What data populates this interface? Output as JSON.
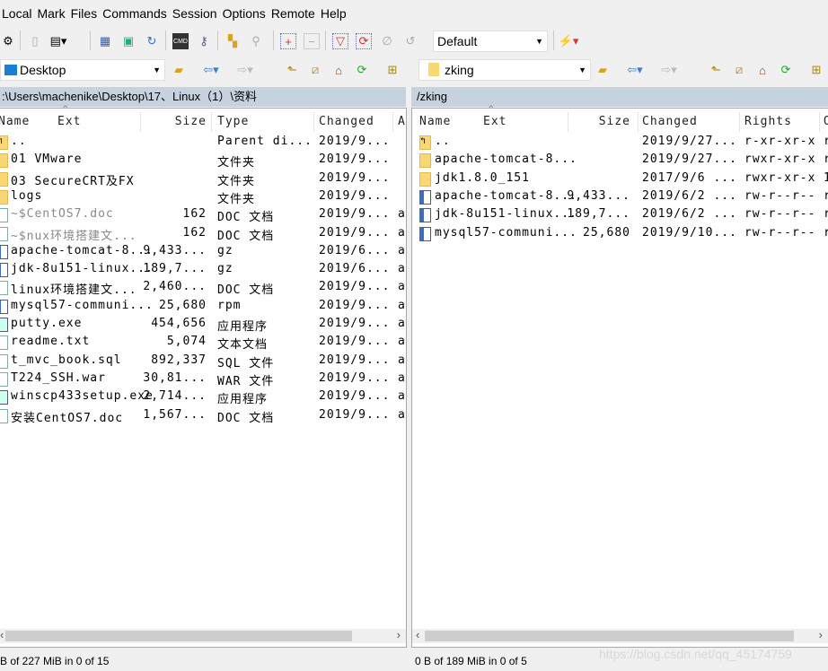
{
  "menu": [
    "Local",
    "Mark",
    "Files",
    "Commands",
    "Session",
    "Options",
    "Remote",
    "Help"
  ],
  "toolbar": {
    "profile": "Default"
  },
  "left": {
    "location": "Desktop",
    "path": ":\\Users\\machenike\\Desktop\\17、Linux（1）\\资料",
    "columns": [
      "Name",
      "Ext",
      "Size",
      "Type",
      "Changed",
      "A"
    ],
    "rows": [
      {
        "icon": "parent-folder",
        "name": "..",
        "size": "",
        "type": "Parent di...",
        "changed": "2019/9...",
        "attr": ""
      },
      {
        "icon": "folder",
        "name": "01 VMware",
        "size": "",
        "type": "文件夹",
        "changed": "2019/9...",
        "attr": ""
      },
      {
        "icon": "folder",
        "name": "03 SecureCRT及FX",
        "size": "",
        "type": "文件夹",
        "changed": "2019/9...",
        "attr": ""
      },
      {
        "icon": "folder",
        "name": "logs",
        "size": "",
        "type": "文件夹",
        "changed": "2019/9...",
        "attr": ""
      },
      {
        "icon": "doc",
        "name": "~$CentOS7.doc",
        "size": "162",
        "type": "DOC 文档",
        "changed": "2019/9...",
        "attr": "a",
        "hidden": true
      },
      {
        "icon": "doc",
        "name": "~$nux环境搭建文...",
        "size": "162",
        "type": "DOC 文档",
        "changed": "2019/9...",
        "attr": "a",
        "hidden": true
      },
      {
        "icon": "package",
        "name": "apache-tomcat-8...",
        "size": "9,433...",
        "type": "gz",
        "changed": "2019/6...",
        "attr": "a"
      },
      {
        "icon": "package",
        "name": "jdk-8u151-linux...",
        "size": "189,7...",
        "type": "gz",
        "changed": "2019/6...",
        "attr": "a"
      },
      {
        "icon": "doc",
        "name": "linux环境搭建文...",
        "size": "2,460...",
        "type": "DOC 文档",
        "changed": "2019/9...",
        "attr": "a"
      },
      {
        "icon": "package",
        "name": "mysql57-communi...",
        "size": "25,680",
        "type": "rpm",
        "changed": "2019/9...",
        "attr": "a"
      },
      {
        "icon": "exe",
        "name": "putty.exe",
        "size": "454,656",
        "type": "应用程序",
        "changed": "2019/9...",
        "attr": "a"
      },
      {
        "icon": "doc",
        "name": "readme.txt",
        "size": "5,074",
        "type": "文本文档",
        "changed": "2019/9...",
        "attr": "a"
      },
      {
        "icon": "doc",
        "name": "t_mvc_book.sql",
        "size": "892,337",
        "type": "SQL 文件",
        "changed": "2019/9...",
        "attr": "a"
      },
      {
        "icon": "doc",
        "name": "T224_SSH.war",
        "size": "30,81...",
        "type": "WAR 文件",
        "changed": "2019/9...",
        "attr": "a"
      },
      {
        "icon": "exe",
        "name": "winscp433setup.exe",
        "size": "2,714...",
        "type": "应用程序",
        "changed": "2019/9...",
        "attr": "a"
      },
      {
        "icon": "doc",
        "name": "安装CentOS7.doc",
        "size": "1,567...",
        "type": "DOC 文档",
        "changed": "2019/9...",
        "attr": "a"
      }
    ],
    "status": "B of 227 MiB in 0 of 15"
  },
  "right": {
    "location": "zking",
    "path": "/zking",
    "columns": [
      "Name",
      "Ext",
      "Size",
      "Changed",
      "Rights",
      "O"
    ],
    "rows": [
      {
        "icon": "parent-folder",
        "name": "..",
        "size": "",
        "changed": "2019/9/27...",
        "rights": "r-xr-xr-x",
        "owner": "r"
      },
      {
        "icon": "folder",
        "name": "apache-tomcat-8...",
        "size": "",
        "changed": "2019/9/27...",
        "rights": "rwxr-xr-x",
        "owner": "r"
      },
      {
        "icon": "folder",
        "name": "jdk1.8.0_151",
        "size": "",
        "changed": "2017/9/6 ...",
        "rights": "rwxr-xr-x",
        "owner": "1"
      },
      {
        "icon": "package",
        "name": "apache-tomcat-8...",
        "size": "9,433...",
        "changed": "2019/6/2 ...",
        "rights": "rw-r--r--",
        "owner": "r"
      },
      {
        "icon": "package",
        "name": "jdk-8u151-linux...",
        "size": "189,7...",
        "changed": "2019/6/2 ...",
        "rights": "rw-r--r--",
        "owner": "r"
      },
      {
        "icon": "package",
        "name": "mysql57-communi...",
        "size": "25,680",
        "changed": "2019/9/10...",
        "rights": "rw-r--r--",
        "owner": "r"
      }
    ],
    "status": "0 B of 189 MiB in 0 of 5"
  },
  "watermark": "https://blog.csdn.net/qq_45174759"
}
